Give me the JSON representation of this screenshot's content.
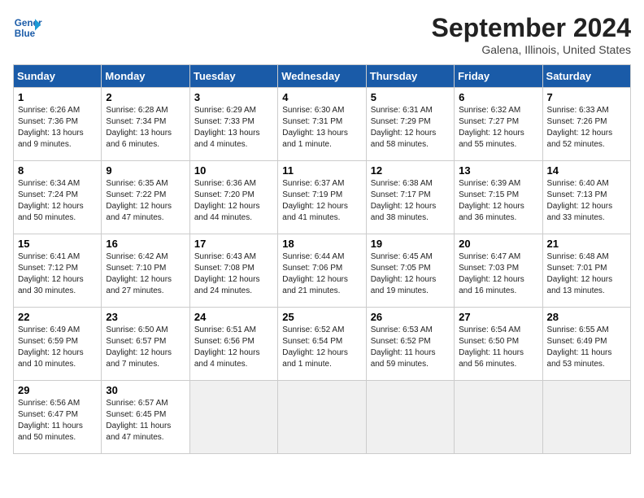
{
  "header": {
    "logo_line1": "General",
    "logo_line2": "Blue",
    "month": "September 2024",
    "location": "Galena, Illinois, United States"
  },
  "weekdays": [
    "Sunday",
    "Monday",
    "Tuesday",
    "Wednesday",
    "Thursday",
    "Friday",
    "Saturday"
  ],
  "weeks": [
    [
      {
        "day": "1",
        "sunrise": "6:26 AM",
        "sunset": "7:36 PM",
        "daylight": "13 hours and 9 minutes"
      },
      {
        "day": "2",
        "sunrise": "6:28 AM",
        "sunset": "7:34 PM",
        "daylight": "13 hours and 6 minutes"
      },
      {
        "day": "3",
        "sunrise": "6:29 AM",
        "sunset": "7:33 PM",
        "daylight": "13 hours and 4 minutes"
      },
      {
        "day": "4",
        "sunrise": "6:30 AM",
        "sunset": "7:31 PM",
        "daylight": "13 hours and 1 minute"
      },
      {
        "day": "5",
        "sunrise": "6:31 AM",
        "sunset": "7:29 PM",
        "daylight": "12 hours and 58 minutes"
      },
      {
        "day": "6",
        "sunrise": "6:32 AM",
        "sunset": "7:27 PM",
        "daylight": "12 hours and 55 minutes"
      },
      {
        "day": "7",
        "sunrise": "6:33 AM",
        "sunset": "7:26 PM",
        "daylight": "12 hours and 52 minutes"
      }
    ],
    [
      {
        "day": "8",
        "sunrise": "6:34 AM",
        "sunset": "7:24 PM",
        "daylight": "12 hours and 50 minutes"
      },
      {
        "day": "9",
        "sunrise": "6:35 AM",
        "sunset": "7:22 PM",
        "daylight": "12 hours and 47 minutes"
      },
      {
        "day": "10",
        "sunrise": "6:36 AM",
        "sunset": "7:20 PM",
        "daylight": "12 hours and 44 minutes"
      },
      {
        "day": "11",
        "sunrise": "6:37 AM",
        "sunset": "7:19 PM",
        "daylight": "12 hours and 41 minutes"
      },
      {
        "day": "12",
        "sunrise": "6:38 AM",
        "sunset": "7:17 PM",
        "daylight": "12 hours and 38 minutes"
      },
      {
        "day": "13",
        "sunrise": "6:39 AM",
        "sunset": "7:15 PM",
        "daylight": "12 hours and 36 minutes"
      },
      {
        "day": "14",
        "sunrise": "6:40 AM",
        "sunset": "7:13 PM",
        "daylight": "12 hours and 33 minutes"
      }
    ],
    [
      {
        "day": "15",
        "sunrise": "6:41 AM",
        "sunset": "7:12 PM",
        "daylight": "12 hours and 30 minutes"
      },
      {
        "day": "16",
        "sunrise": "6:42 AM",
        "sunset": "7:10 PM",
        "daylight": "12 hours and 27 minutes"
      },
      {
        "day": "17",
        "sunrise": "6:43 AM",
        "sunset": "7:08 PM",
        "daylight": "12 hours and 24 minutes"
      },
      {
        "day": "18",
        "sunrise": "6:44 AM",
        "sunset": "7:06 PM",
        "daylight": "12 hours and 21 minutes"
      },
      {
        "day": "19",
        "sunrise": "6:45 AM",
        "sunset": "7:05 PM",
        "daylight": "12 hours and 19 minutes"
      },
      {
        "day": "20",
        "sunrise": "6:47 AM",
        "sunset": "7:03 PM",
        "daylight": "12 hours and 16 minutes"
      },
      {
        "day": "21",
        "sunrise": "6:48 AM",
        "sunset": "7:01 PM",
        "daylight": "12 hours and 13 minutes"
      }
    ],
    [
      {
        "day": "22",
        "sunrise": "6:49 AM",
        "sunset": "6:59 PM",
        "daylight": "12 hours and 10 minutes"
      },
      {
        "day": "23",
        "sunrise": "6:50 AM",
        "sunset": "6:57 PM",
        "daylight": "12 hours and 7 minutes"
      },
      {
        "day": "24",
        "sunrise": "6:51 AM",
        "sunset": "6:56 PM",
        "daylight": "12 hours and 4 minutes"
      },
      {
        "day": "25",
        "sunrise": "6:52 AM",
        "sunset": "6:54 PM",
        "daylight": "12 hours and 1 minute"
      },
      {
        "day": "26",
        "sunrise": "6:53 AM",
        "sunset": "6:52 PM",
        "daylight": "11 hours and 59 minutes"
      },
      {
        "day": "27",
        "sunrise": "6:54 AM",
        "sunset": "6:50 PM",
        "daylight": "11 hours and 56 minutes"
      },
      {
        "day": "28",
        "sunrise": "6:55 AM",
        "sunset": "6:49 PM",
        "daylight": "11 hours and 53 minutes"
      }
    ],
    [
      {
        "day": "29",
        "sunrise": "6:56 AM",
        "sunset": "6:47 PM",
        "daylight": "11 hours and 50 minutes"
      },
      {
        "day": "30",
        "sunrise": "6:57 AM",
        "sunset": "6:45 PM",
        "daylight": "11 hours and 47 minutes"
      },
      null,
      null,
      null,
      null,
      null
    ]
  ]
}
